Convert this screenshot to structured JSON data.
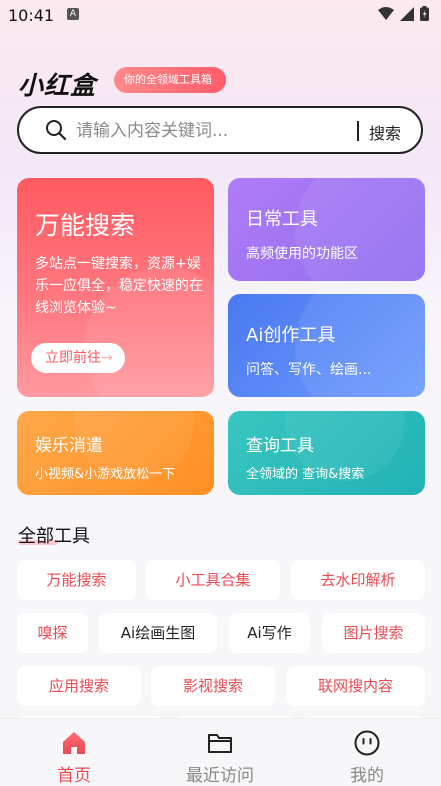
{
  "status": {
    "time": "10:41",
    "notif_letter": "A"
  },
  "brand": {
    "name": "小红盒",
    "tagline": "你的全领域工具箱"
  },
  "search": {
    "placeholder": "请输入内容关键词...",
    "button": "搜索"
  },
  "cards": {
    "universal": {
      "title": "万能搜索",
      "desc": "多站点一键搜索，资源+娱乐一应俱全，稳定快速的在线浏览体验~",
      "button": "立即前往",
      "arrow": "→"
    },
    "daily": {
      "title": "日常工具",
      "sub": "高频使用的功能区"
    },
    "ai": {
      "title": "Ai创作工具",
      "sub": "问答、写作、绘画..."
    },
    "fun": {
      "title": "娱乐消遣",
      "sub": "小视频&小游戏放松一下"
    },
    "query": {
      "title": "查询工具",
      "sub": "全领域的 查询&搜索"
    }
  },
  "section": {
    "title": "全部工具"
  },
  "tools": [
    {
      "label": "万能搜索",
      "color": "#e94a52"
    },
    {
      "label": "小工具合集",
      "color": "#e94a52"
    },
    {
      "label": "去水印解析",
      "color": "#e94a52"
    },
    {
      "label": "嗅探",
      "color": "#e94a52"
    },
    {
      "label": "Ai绘画生图",
      "color": "#222222"
    },
    {
      "label": "Ai写作",
      "color": "#222222"
    },
    {
      "label": "图片搜索",
      "color": "#e94a52"
    },
    {
      "label": "应用搜索",
      "color": "#e94a52"
    },
    {
      "label": "影视搜索",
      "color": "#e94a52"
    },
    {
      "label": "联网搜内容",
      "color": "#e94a52"
    }
  ],
  "tabbar": [
    {
      "label": "首页",
      "icon": "home-icon",
      "active": true
    },
    {
      "label": "最近访问",
      "icon": "folder-icon",
      "active": false
    },
    {
      "label": "我的",
      "icon": "profile-face-icon",
      "active": false
    }
  ],
  "colors": {
    "accent": "#e94a52"
  }
}
